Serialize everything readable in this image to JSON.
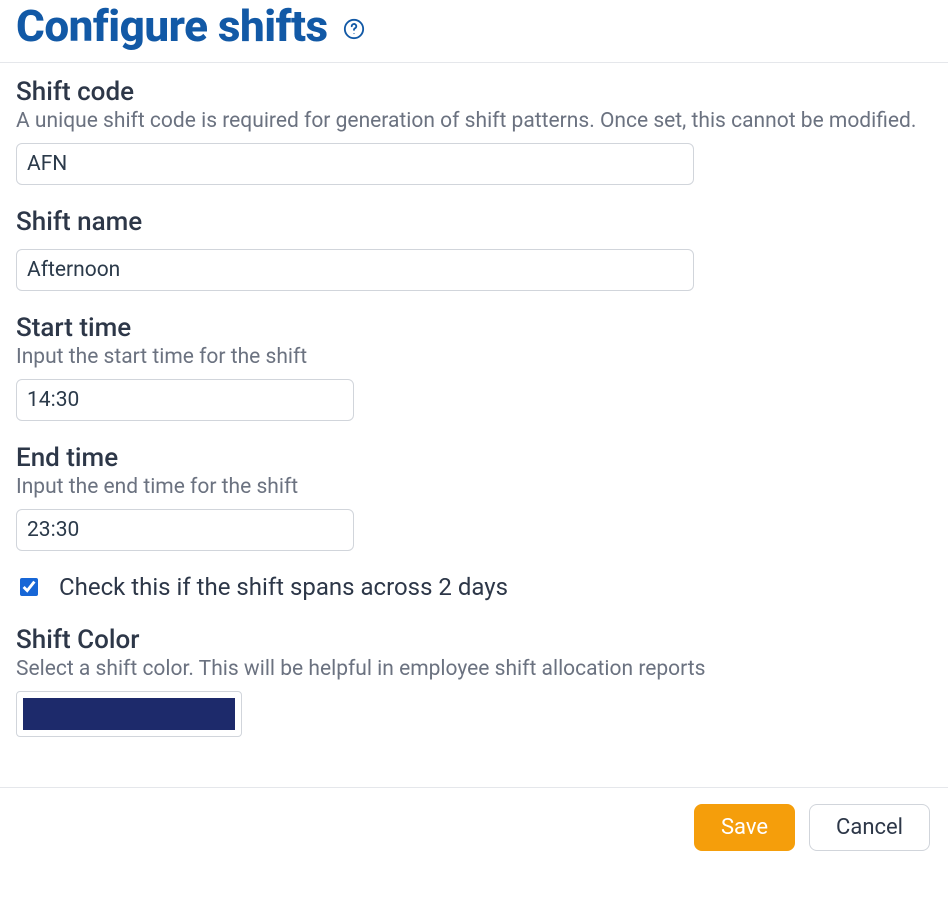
{
  "header": {
    "title": "Configure shifts"
  },
  "form": {
    "shift_code": {
      "label": "Shift code",
      "help": "A unique shift code is required for generation of shift patterns. Once set, this cannot be modified.",
      "value": "AFN"
    },
    "shift_name": {
      "label": "Shift name",
      "value": "Afternoon"
    },
    "start_time": {
      "label": "Start time",
      "help": "Input the start time for the shift",
      "value": "14:30"
    },
    "end_time": {
      "label": "End time",
      "help": "Input the end time for the shift",
      "value": "23:30"
    },
    "spans_two_days": {
      "label": "Check this if the shift spans across 2 days",
      "checked": true
    },
    "shift_color": {
      "label": "Shift Color",
      "help": "Select a shift color. This will be helpful in employee shift allocation reports",
      "value": "#1d2a6b"
    }
  },
  "footer": {
    "save": "Save",
    "cancel": "Cancel"
  }
}
